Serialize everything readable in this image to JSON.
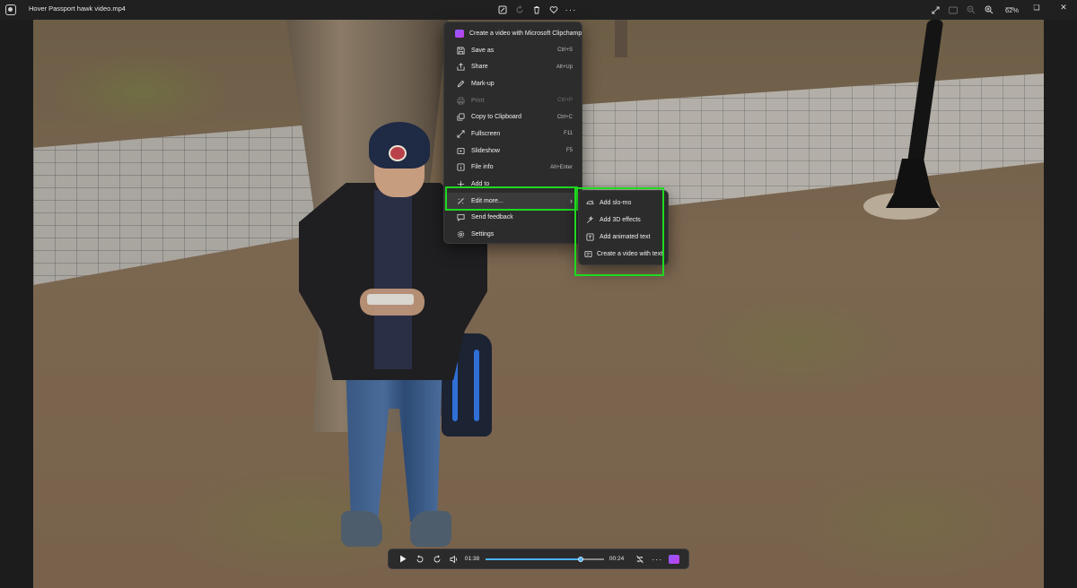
{
  "window": {
    "file_title": "Hover Passport hawk video.mp4",
    "zoom_label": "62%"
  },
  "toolbar": {
    "center_icons": [
      "edit-image-icon",
      "rotate-icon",
      "delete-icon",
      "favorite-icon",
      "more-icon"
    ],
    "right_icons": [
      "fullscreen-icon",
      "actual-size-icon",
      "zoom-out-icon",
      "zoom-in-icon"
    ],
    "window_icons": [
      "minimize-icon",
      "maximize-icon",
      "close-icon"
    ]
  },
  "context_menu": {
    "items": [
      {
        "label": "Create a video with Microsoft Clipchamp",
        "shortcut": "",
        "icon": "clipchamp-icon",
        "disabled": false
      },
      {
        "label": "Save as",
        "shortcut": "Ctrl+S",
        "icon": "save-icon",
        "disabled": false
      },
      {
        "label": "Share",
        "shortcut": "Alt+Up",
        "icon": "share-icon",
        "disabled": false
      },
      {
        "label": "Mark-up",
        "shortcut": "",
        "icon": "pen-icon",
        "disabled": false
      },
      {
        "label": "Print",
        "shortcut": "Ctrl+P",
        "icon": "print-icon",
        "disabled": true
      },
      {
        "label": "Copy to Clipboard",
        "shortcut": "Ctrl+C",
        "icon": "copy-icon",
        "disabled": false
      },
      {
        "label": "Fullscreen",
        "shortcut": "F11",
        "icon": "fullscreen-icon",
        "disabled": false
      },
      {
        "label": "Slideshow",
        "shortcut": "F5",
        "icon": "slideshow-icon",
        "disabled": false
      },
      {
        "label": "File info",
        "shortcut": "Alt+Enter",
        "icon": "info-icon",
        "disabled": false
      },
      {
        "label": "Add to",
        "shortcut": "",
        "icon": "plus-icon",
        "disabled": false
      },
      {
        "label": "Edit more...",
        "shortcut": "",
        "icon": "edit-more-icon",
        "disabled": false,
        "has_submenu": true
      },
      {
        "label": "Send feedback",
        "shortcut": "",
        "icon": "feedback-icon",
        "disabled": false
      },
      {
        "label": "Settings",
        "shortcut": "",
        "icon": "gear-icon",
        "disabled": false
      }
    ]
  },
  "submenu": {
    "items": [
      {
        "label": "Add slo-mo",
        "icon": "slomo-icon"
      },
      {
        "label": "Add 3D effects",
        "icon": "effects-icon"
      },
      {
        "label": "Add animated text",
        "icon": "animated-text-icon"
      },
      {
        "label": "Create a video with text",
        "icon": "video-text-icon"
      }
    ]
  },
  "player": {
    "current_time": "01:38",
    "remaining_time": "00:24",
    "progress": 0.81
  },
  "colors": {
    "highlight": "#1fd91f",
    "accent": "#4db2ff"
  }
}
